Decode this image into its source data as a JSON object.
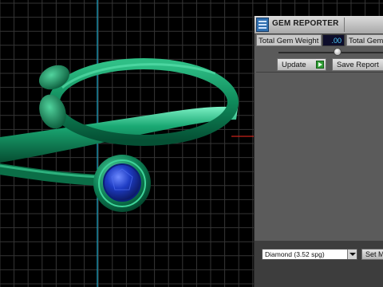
{
  "gem_reporter": {
    "title": "GEM REPORTER",
    "total_gem_weight_label": "Total Gem Weight",
    "total_gem_weight_value": ".00",
    "total_gem_count_label": "Total Gem",
    "slider_position": 0.56,
    "update_label": "Update",
    "save_report_label": "Save Report",
    "gem_type_selected": "Diamond    (3.52 spg)",
    "set_button_label": "Set M"
  },
  "colors": {
    "ring_green": "#0e8a5b",
    "gem_blue": "#1a3fb5",
    "grid_line": "#3a3a3a",
    "axis_cyan": "#1aa6c8",
    "axis_red": "#c8221a",
    "panel_gray": "#5a5a5a"
  }
}
